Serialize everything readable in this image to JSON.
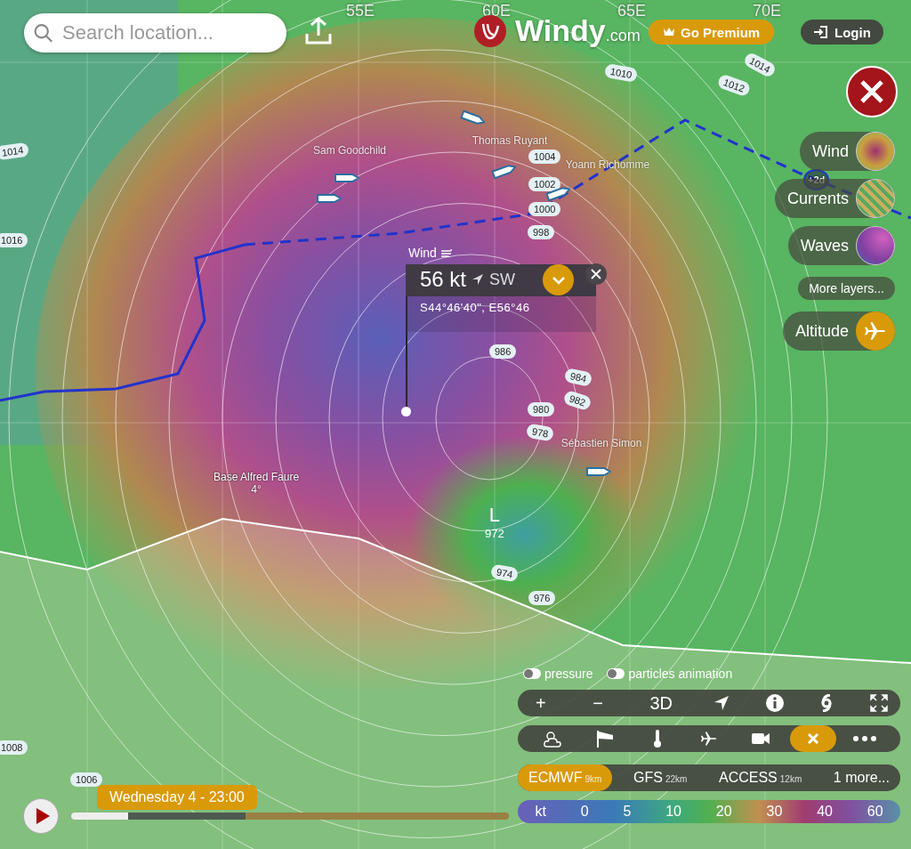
{
  "header": {
    "search": {
      "placeholder": "Search location..."
    },
    "logo": {
      "name": "Windy",
      "suffix": ".com"
    },
    "premium": "Go Premium",
    "login": "Login"
  },
  "grid_labels": [
    "55E",
    "60E",
    "65E",
    "70E"
  ],
  "isobars": [
    "1014",
    "1010",
    "1012",
    "1014",
    "1004",
    "1002",
    "1000",
    "998",
    "1016",
    "986",
    "984",
    "982",
    "980",
    "978",
    "974",
    "976",
    "1008",
    "1006"
  ],
  "places": [
    {
      "name": "Base Alfred Faure",
      "temp": "4°"
    }
  ],
  "low": {
    "letter": "L",
    "value": "972"
  },
  "boats": [
    {
      "name": "Thomas Ruyant"
    },
    {
      "name": "Yoann Richomme"
    },
    {
      "name": "Sam Goodchild"
    },
    {
      "name": "Sébastien Simon"
    }
  ],
  "forecast_badge": "+2d",
  "popup": {
    "layer": "Wind",
    "speed": "56 kt",
    "direction": "SW",
    "coords": "S44°46'40\", E56°46"
  },
  "layers": [
    {
      "label": "Wind",
      "kind": "wind"
    },
    {
      "label": "Currents",
      "kind": "currents"
    },
    {
      "label": "Waves",
      "kind": "waves"
    }
  ],
  "more_layers": "More layers...",
  "altitude": "Altitude",
  "toggles": [
    {
      "label": "pressure",
      "on": true
    },
    {
      "label": "particles animation",
      "on": true
    }
  ],
  "toolbar": [
    {
      "kind": "text",
      "label": "+"
    },
    {
      "kind": "text",
      "label": "−"
    },
    {
      "kind": "text",
      "label": "3D"
    },
    {
      "kind": "locate"
    },
    {
      "kind": "info"
    },
    {
      "kind": "hurricane"
    },
    {
      "kind": "fullscreen"
    }
  ],
  "overlays": [
    {
      "kind": "weather",
      "selected": false
    },
    {
      "kind": "windsock",
      "selected": false
    },
    {
      "kind": "thermometer",
      "selected": false
    },
    {
      "kind": "plane",
      "selected": false
    },
    {
      "kind": "camera",
      "selected": false
    },
    {
      "kind": "close",
      "selected": true
    },
    {
      "kind": "more",
      "selected": false
    }
  ],
  "models": [
    {
      "name": "ECMWF",
      "resolution": "9km",
      "selected": true
    },
    {
      "name": "GFS",
      "resolution": "22km",
      "selected": false
    },
    {
      "name": "ACCESS",
      "resolution": "12km",
      "selected": false
    },
    {
      "name": "1 more...",
      "selected": false
    }
  ],
  "legend": {
    "unit": "kt",
    "values": [
      "0",
      "5",
      "10",
      "20",
      "30",
      "40",
      "60"
    ]
  },
  "timeline": {
    "label": "Wednesday 4 - 23:00",
    "level": 0.13
  }
}
